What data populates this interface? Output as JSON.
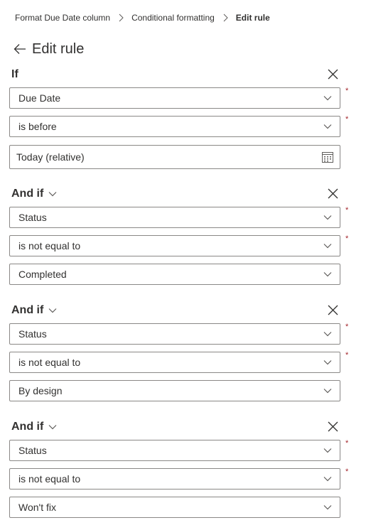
{
  "breadcrumb": {
    "items": [
      "Format Due Date column",
      "Conditional formatting"
    ],
    "current": "Edit rule"
  },
  "header": {
    "title": "Edit rule"
  },
  "required_marker": "*",
  "first_condition": {
    "label": "If",
    "field": "Due Date",
    "operator": "is before",
    "value": "Today (relative)"
  },
  "and_conditions": [
    {
      "label": "And if",
      "field": "Status",
      "operator": "is not equal to",
      "value": "Completed"
    },
    {
      "label": "And if",
      "field": "Status",
      "operator": "is not equal to",
      "value": "By design"
    },
    {
      "label": "And if",
      "field": "Status",
      "operator": "is not equal to",
      "value": "Won't fix"
    }
  ],
  "colors": {
    "text": "#323130",
    "border": "#8a8886",
    "required": "#a4262c"
  }
}
